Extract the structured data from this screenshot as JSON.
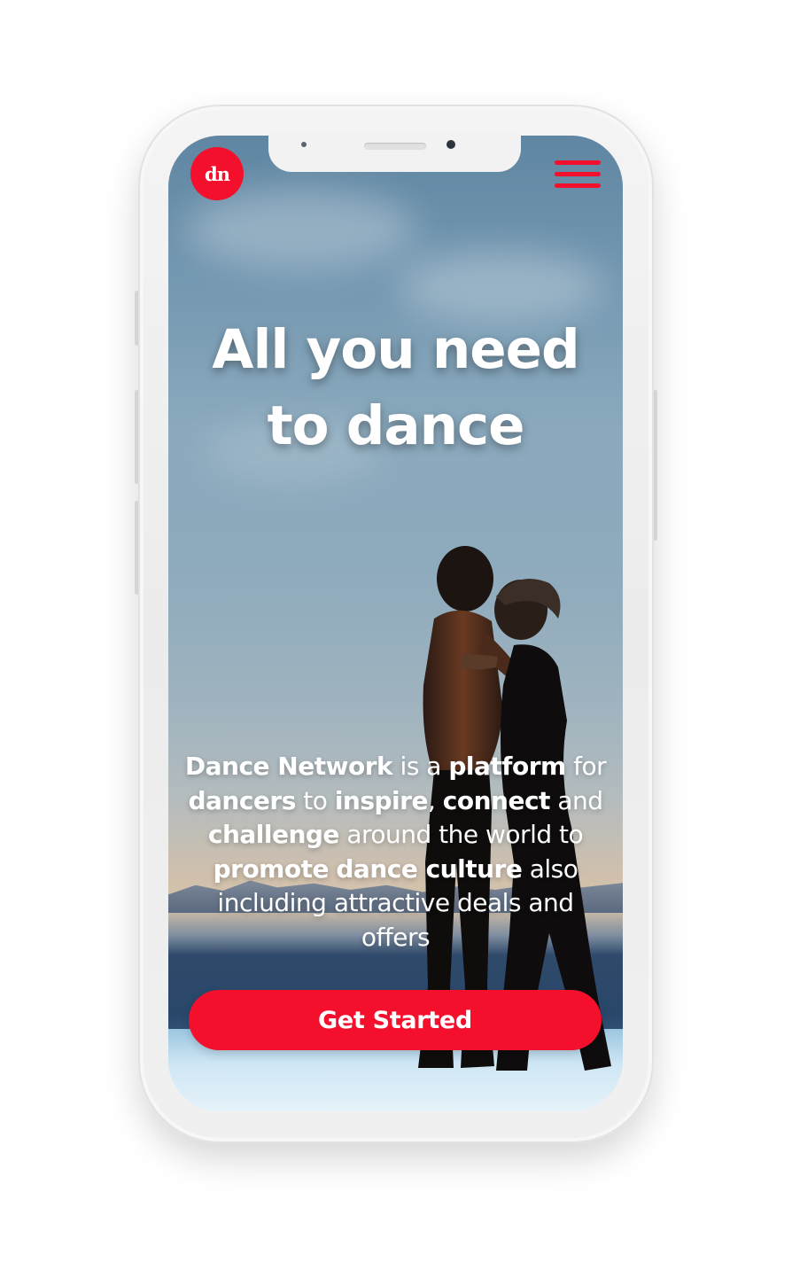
{
  "app": {
    "logo_text": "dn",
    "logo_icon": "dance-network-logo",
    "menu_icon": "hamburger-menu-icon",
    "accent_color": "#f4102c"
  },
  "hero": {
    "headline_line1": "All you need",
    "headline_line2": "to dance"
  },
  "description": {
    "parts": [
      {
        "text": "Dance Network",
        "bold": true
      },
      {
        "text": " is a ",
        "bold": false
      },
      {
        "text": "platform",
        "bold": true
      },
      {
        "text": " for ",
        "bold": false
      },
      {
        "text": "dancers",
        "bold": true
      },
      {
        "text": " to ",
        "bold": false
      },
      {
        "text": "inspire",
        "bold": true
      },
      {
        "text": ", ",
        "bold": false
      },
      {
        "text": "connect",
        "bold": true
      },
      {
        "text": " and ",
        "bold": false
      },
      {
        "text": "challenge",
        "bold": true
      },
      {
        "text": " around the world to ",
        "bold": false
      },
      {
        "text": "promote",
        "bold": true
      },
      {
        "text": " ",
        "bold": false
      },
      {
        "text": "dance culture",
        "bold": true
      },
      {
        "text": " also including attractive deals and offers",
        "bold": false
      }
    ]
  },
  "cta": {
    "label": "Get Started"
  }
}
